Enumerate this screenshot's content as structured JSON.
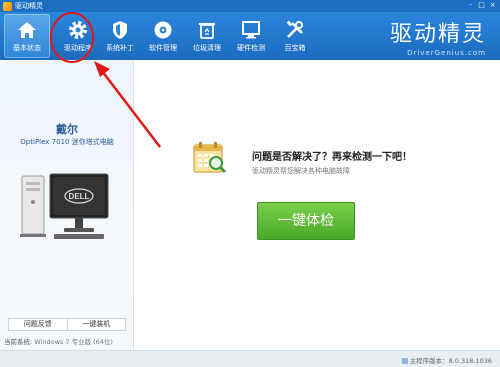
{
  "window": {
    "title": "驱动精灵",
    "controls": [
      "-",
      "□",
      "×"
    ]
  },
  "toolbar": {
    "items": [
      {
        "label": "基本状态",
        "icon": "home-icon",
        "active": true
      },
      {
        "label": "驱动程序",
        "icon": "gear-icon",
        "active": false
      },
      {
        "label": "系统补丁",
        "icon": "shield-icon",
        "active": false
      },
      {
        "label": "软件管理",
        "icon": "disc-icon",
        "active": false
      },
      {
        "label": "垃圾清理",
        "icon": "recycle-bin-icon",
        "active": false
      },
      {
        "label": "硬件检测",
        "icon": "monitor-icon",
        "active": false
      },
      {
        "label": "百宝箱",
        "icon": "tools-icon",
        "active": false
      }
    ],
    "brand_cn": "驱动精灵",
    "brand_en": "DriverGenius.com"
  },
  "left": {
    "brand": "戴尔",
    "model": "OptiPlex 7010 迷你塔式电脑",
    "pc_label": "DELL",
    "feedback_label": "问题反馈",
    "install_label": "一键装机",
    "system_label": "当前系统:",
    "system_value": "Windows 7 专业版 (64位)"
  },
  "main": {
    "question": "问题是否解决了？再来检测一下吧！",
    "subtitle": "驱动精灵帮您解决各种电脑故障",
    "check_button": "一键体检"
  },
  "statusbar": {
    "version_label": "主程序版本：",
    "version_value": "8.0.318.1036"
  },
  "colors": {
    "toolbar": "#1f74c8",
    "button_green": "#5bb735",
    "annotation_red": "#e01818"
  }
}
